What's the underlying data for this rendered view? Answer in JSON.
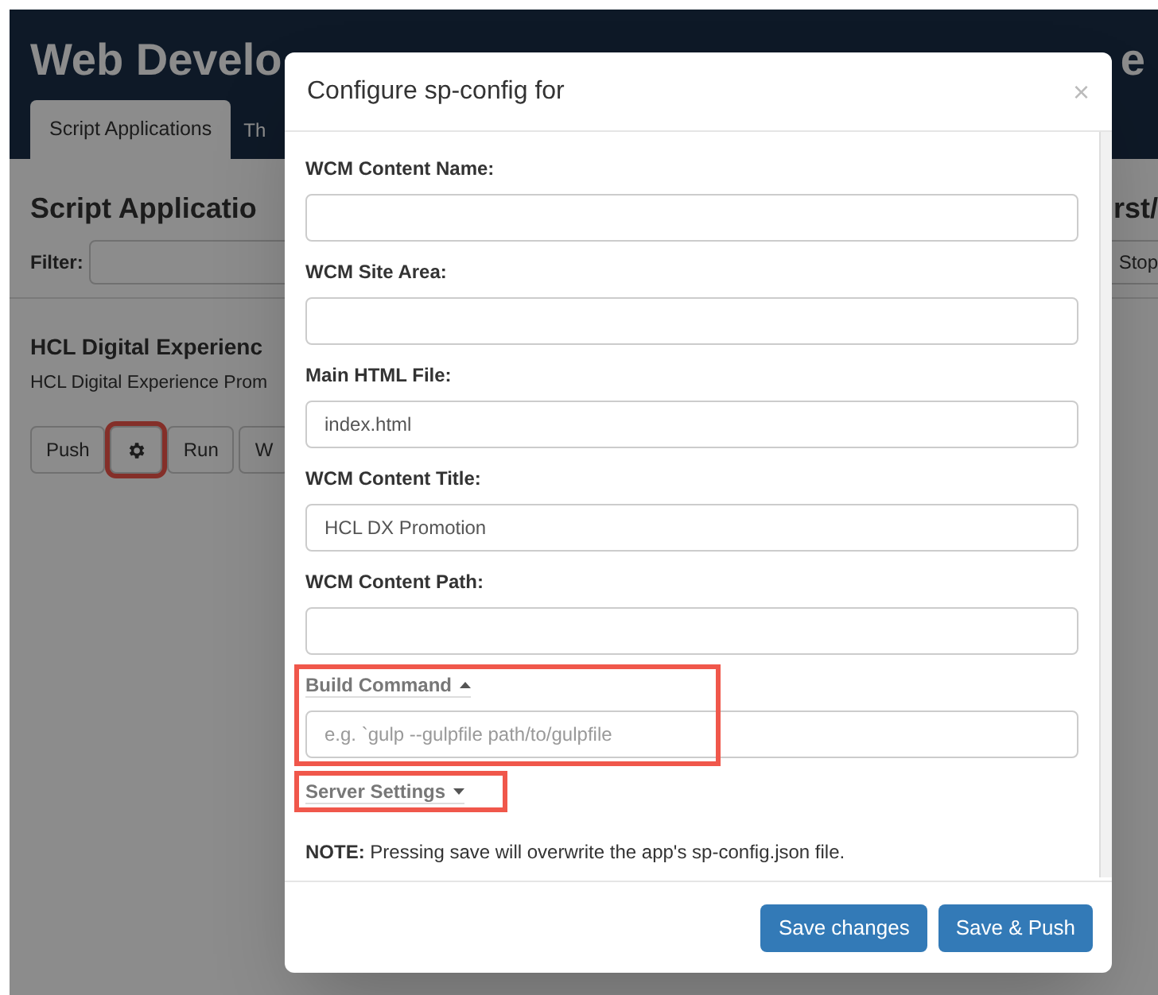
{
  "header": {
    "title_left": "Web Develo",
    "title_right": "e"
  },
  "tabs": [
    {
      "label": "Script Applications",
      "selected": true
    },
    {
      "label": "Th",
      "selected": false
    }
  ],
  "page": {
    "heading": "Script Applicatio",
    "heading_right": "rst/",
    "filter_label": "Filter:",
    "stop_label": "Stop"
  },
  "app_card": {
    "title": "HCL Digital Experienc",
    "description": "HCL Digital Experience Prom",
    "buttons": [
      {
        "kind": "text",
        "label": "Push",
        "highlighted": false
      },
      {
        "kind": "gear",
        "highlighted": true
      },
      {
        "kind": "text",
        "label": "Run",
        "highlighted": false
      },
      {
        "kind": "text",
        "label": "W",
        "highlighted": false
      }
    ]
  },
  "modal": {
    "title": "Configure sp-config for",
    "close": "×",
    "fields": [
      {
        "kind": "input",
        "label": "WCM Content Name:"
      },
      {
        "kind": "input",
        "label": "WCM Site Area:"
      },
      {
        "kind": "input",
        "label": "Main HTML File:",
        "value": "index.html"
      },
      {
        "kind": "input",
        "label": "WCM Content Title:",
        "value": "HCL DX Promotion"
      },
      {
        "kind": "input",
        "label": "WCM Content Path:"
      },
      {
        "kind": "toggle",
        "label": "Build Command",
        "expanded": true,
        "highlighted": true,
        "placeholder": "e.g. `gulp --gulpfile path/to/gulpfile"
      },
      {
        "kind": "toggle",
        "label": "Server Settings",
        "expanded": false,
        "highlighted": true
      }
    ],
    "note": "**NOTE:** Pressing save will overwrite the app's sp-config.json file.",
    "buttons": [
      "Save changes",
      "Save & Push"
    ]
  }
}
